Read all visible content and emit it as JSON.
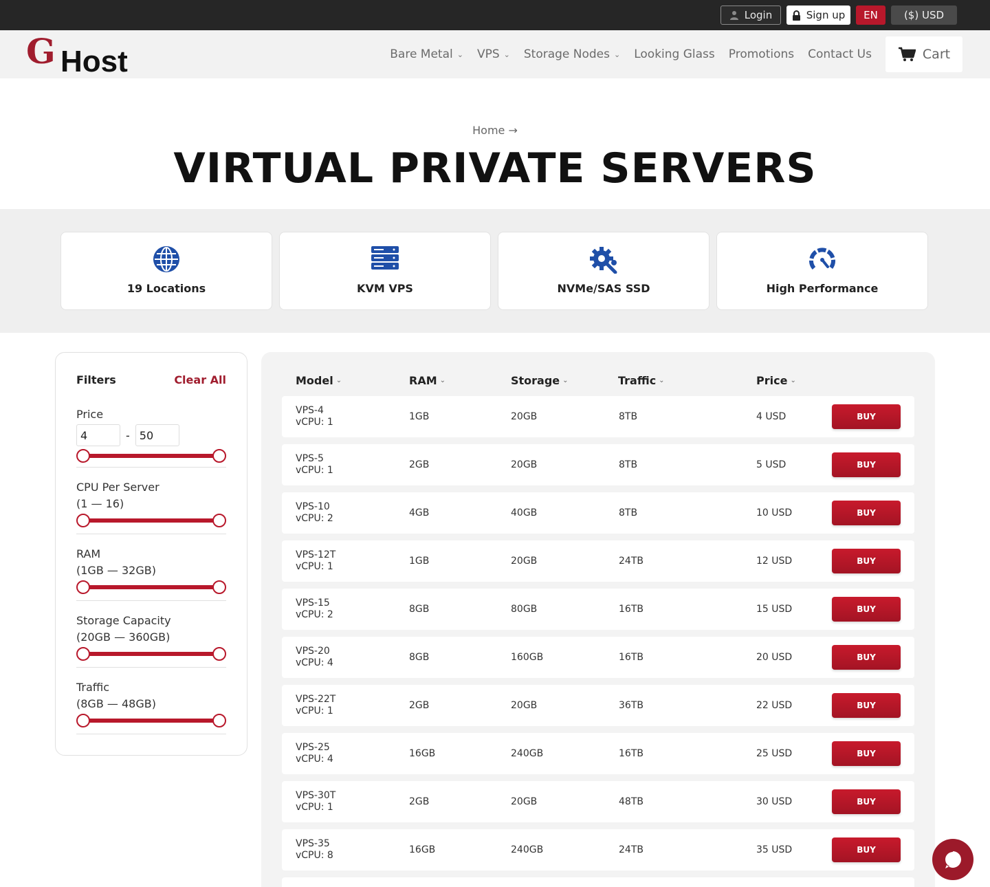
{
  "topbar": {
    "login": "Login",
    "signup": "Sign up",
    "lang": "EN",
    "currency": "($) USD"
  },
  "header": {
    "logo_mark": "G",
    "logo_text": "Host",
    "nav": [
      {
        "label": "Bare Metal",
        "dropdown": true
      },
      {
        "label": "VPS",
        "dropdown": true
      },
      {
        "label": "Storage Nodes",
        "dropdown": true
      },
      {
        "label": "Looking Glass",
        "dropdown": false
      },
      {
        "label": "Promotions",
        "dropdown": false
      },
      {
        "label": "Contact Us",
        "dropdown": false
      }
    ],
    "cart": "Cart"
  },
  "hero": {
    "breadcrumb": "Home",
    "breadcrumb_arrow": "→",
    "title": "VIRTUAL PRIVATE SERVERS"
  },
  "features": [
    {
      "label": "19 Locations",
      "icon": "globe-icon"
    },
    {
      "label": "KVM VPS",
      "icon": "server-icon"
    },
    {
      "label": "NVMe/SAS SSD",
      "icon": "gear-wrench-icon"
    },
    {
      "label": "High Performance",
      "icon": "speedometer-icon"
    }
  ],
  "filters": {
    "title": "Filters",
    "clear": "Clear All",
    "price": {
      "label": "Price",
      "min": "4",
      "sep": "-",
      "max": "50"
    },
    "cpu": {
      "label": "CPU Per Server",
      "range": "(1 — 16)"
    },
    "ram": {
      "label": "RAM",
      "range": "(1GB — 32GB)"
    },
    "storage": {
      "label": "Storage Capacity",
      "range": "(20GB — 360GB)"
    },
    "traffic": {
      "label": "Traffic",
      "range": "(8GB — 48GB)"
    }
  },
  "table": {
    "columns": {
      "model": "Model",
      "ram": "RAM",
      "storage": "Storage",
      "traffic": "Traffic",
      "price": "Price"
    },
    "buy_label": "BUY",
    "rows": [
      {
        "model": "VPS-4",
        "cpu": "vCPU: 1",
        "ram": "1GB",
        "storage": "20GB",
        "traffic": "8TB",
        "price": "4 USD"
      },
      {
        "model": "VPS-5",
        "cpu": "vCPU: 1",
        "ram": "2GB",
        "storage": "20GB",
        "traffic": "8TB",
        "price": "5 USD"
      },
      {
        "model": "VPS-10",
        "cpu": "vCPU: 2",
        "ram": "4GB",
        "storage": "40GB",
        "traffic": "8TB",
        "price": "10 USD"
      },
      {
        "model": "VPS-12T",
        "cpu": "vCPU: 1",
        "ram": "1GB",
        "storage": "20GB",
        "traffic": "24TB",
        "price": "12 USD"
      },
      {
        "model": "VPS-15",
        "cpu": "vCPU: 2",
        "ram": "8GB",
        "storage": "80GB",
        "traffic": "16TB",
        "price": "15 USD"
      },
      {
        "model": "VPS-20",
        "cpu": "vCPU: 4",
        "ram": "8GB",
        "storage": "160GB",
        "traffic": "16TB",
        "price": "20 USD"
      },
      {
        "model": "VPS-22T",
        "cpu": "vCPU: 1",
        "ram": "2GB",
        "storage": "20GB",
        "traffic": "36TB",
        "price": "22 USD"
      },
      {
        "model": "VPS-25",
        "cpu": "vCPU: 4",
        "ram": "16GB",
        "storage": "240GB",
        "traffic": "16TB",
        "price": "25 USD"
      },
      {
        "model": "VPS-30T",
        "cpu": "vCPU: 1",
        "ram": "2GB",
        "storage": "20GB",
        "traffic": "48TB",
        "price": "30 USD"
      },
      {
        "model": "VPS-35",
        "cpu": "vCPU: 8",
        "ram": "16GB",
        "storage": "240GB",
        "traffic": "24TB",
        "price": "35 USD"
      }
    ]
  },
  "colors": {
    "accent": "#b8182b",
    "brand": "#a01d2e",
    "topbar": "#262626"
  }
}
